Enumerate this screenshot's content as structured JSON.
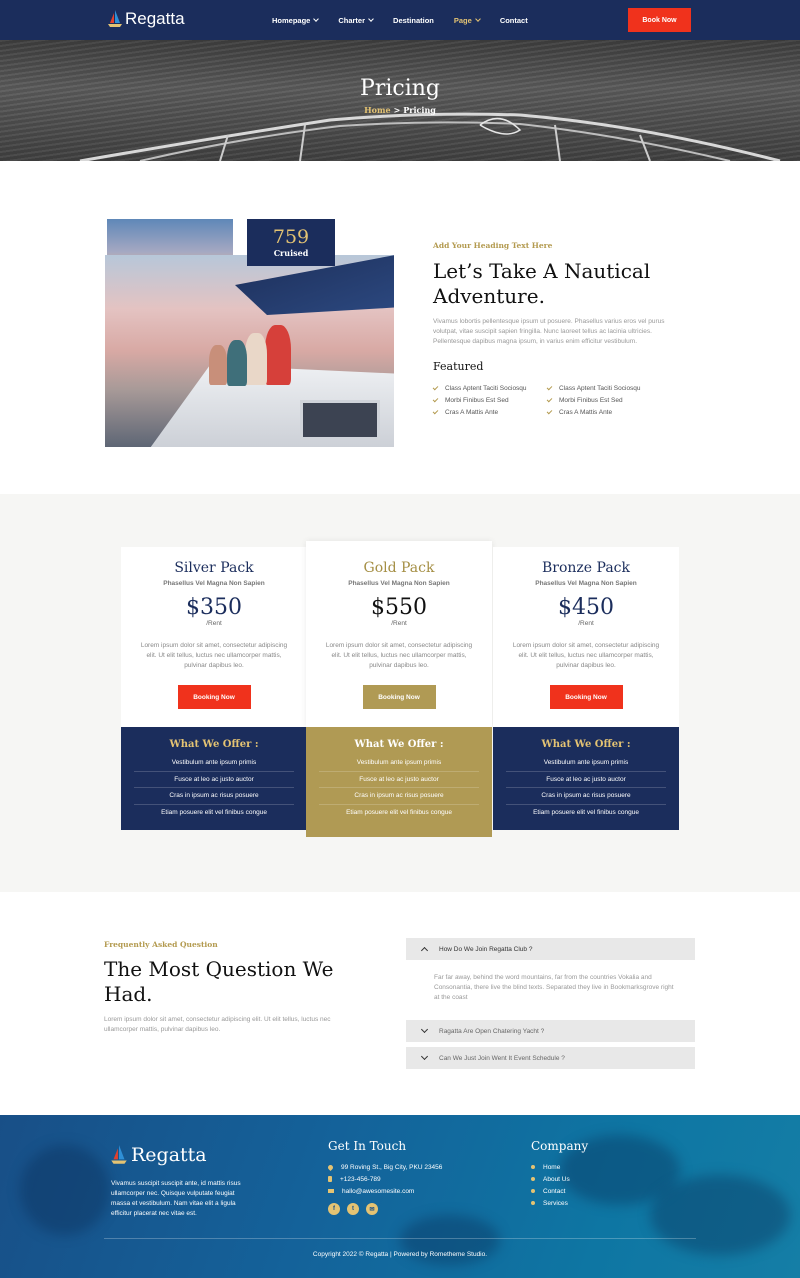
{
  "brand": {
    "name": "Regatta"
  },
  "nav": {
    "items": [
      {
        "label": "Homepage",
        "has_dropdown": true,
        "active": false
      },
      {
        "label": "Charter",
        "has_dropdown": true,
        "active": false
      },
      {
        "label": "Destination",
        "has_dropdown": false,
        "active": false
      },
      {
        "label": "Page",
        "has_dropdown": true,
        "active": true
      },
      {
        "label": "Contact",
        "has_dropdown": false,
        "active": false
      }
    ],
    "cta": "Book Now"
  },
  "hero": {
    "title": "Pricing",
    "breadcrumb": {
      "home": "Home",
      "separator": ">",
      "current": "Pricing"
    }
  },
  "about": {
    "stat": {
      "value": "759",
      "label": "Cruised"
    },
    "kicker": "Add Your Heading Text Here",
    "title": "Let’s Take A Nautical Adventure.",
    "text": "Vivamus lobortis pellentesque ipsum ut posuere. Phasellus varius eros vel purus volutpat, vitae suscipit sapien fringilla. Nunc laoreet tellus ac lacinia ultricies. Pellentesque dapibus magna ipsum, in varius enim efficitur vestibulum.",
    "featured_title": "Featured",
    "featured_left": [
      "Class Aptent Taciti Sociosqu",
      "Morbi Finibus Est Sed",
      "Cras A Mattis Ante"
    ],
    "featured_right": [
      "Class Aptent Taciti Sociosqu",
      "Morbi Finibus Est Sed",
      "Cras A Mattis Ante"
    ]
  },
  "pricing": {
    "plans": [
      {
        "name": "Silver Pack",
        "subtitle": "Phasellus Vel Magna Non Sapien",
        "price": "$350",
        "unit": "/Rent",
        "description": "Lorem ipsum dolor sit amet, consectetur adipiscing elit. Ut elit tellus, luctus nec ullamcorper mattis, pulvinar dapibus leo.",
        "button": "Booking Now",
        "offer_title": "What We Offer :",
        "offers": [
          "Vestibulum ante ipsum primis",
          "Fusce at leo ac justo auctor",
          "Cras in ipsum ac risus posuere",
          "Etiam posuere elit vel finibus congue"
        ]
      },
      {
        "name": "Gold Pack",
        "subtitle": "Phasellus Vel Magna Non Sapien",
        "price": "$550",
        "unit": "/Rent",
        "description": "Lorem ipsum dolor sit amet, consectetur adipiscing elit. Ut elit tellus, luctus nec ullamcorper mattis, pulvinar dapibus leo.",
        "button": "Booking Now",
        "offer_title": "What We Offer :",
        "offers": [
          "Vestibulum ante ipsum primis",
          "Fusce at leo ac justo auctor",
          "Cras in ipsum ac risus posuere",
          "Etiam posuere elit vel finibus congue"
        ]
      },
      {
        "name": "Bronze Pack",
        "subtitle": "Phasellus Vel Magna Non Sapien",
        "price": "$450",
        "unit": "/Rent",
        "description": "Lorem ipsum dolor sit amet, consectetur adipiscing elit. Ut elit tellus, luctus nec ullamcorper mattis, pulvinar dapibus leo.",
        "button": "Booking Now",
        "offer_title": "What We Offer :",
        "offers": [
          "Vestibulum ante ipsum primis",
          "Fusce at leo ac justo auctor",
          "Cras in ipsum ac risus posuere",
          "Etiam posuere elit vel finibus congue"
        ]
      }
    ]
  },
  "faq": {
    "kicker": "Frequently Asked Question",
    "title": "The Most Question We Had.",
    "text": "Lorem ipsum dolor sit amet, consectetur adipiscing elit. Ut elit tellus, luctus nec ullamcorper mattis, pulvinar dapibus leo.",
    "items": [
      {
        "question": "How Do We Join Regatta Club ?",
        "expanded": true,
        "answer": "Far far away, behind the word mountains, far from the countries Vokalia and Consonantia, there live the blind texts. Separated they live in Bookmarksgrove right at the coast"
      },
      {
        "question": "Ragatta Are Open Chatering Yacht ?",
        "expanded": false
      },
      {
        "question": "Can We Just Join Went It Event Schedule ?",
        "expanded": false
      }
    ]
  },
  "footer": {
    "about": "Vivamus suscipit suscipit ante, id mattis risus ullamcorper nec. Quisque vulputate feugiat massa et vestibulum. Nam vitae elit a ligula efficitur placerat nec vitae est.",
    "contact_title": "Get In Touch",
    "address": "99 Roving St., Big City, PKU 23456",
    "phone": "+123-456-789",
    "email": "hallo@awesomesite.com",
    "social_icons": [
      "facebook-icon",
      "twitter-icon",
      "mail-icon"
    ],
    "company_title": "Company",
    "links": [
      "Home",
      "About Us",
      "Contact",
      "Services"
    ],
    "copyright": "Copyright 2022 © Regatta | Powered by Rometheme Studio."
  },
  "colors": {
    "navy": "#1b2d5c",
    "gold": "#b09a54",
    "accent_red": "#f0321c",
    "gold_text": "#e4c373"
  }
}
